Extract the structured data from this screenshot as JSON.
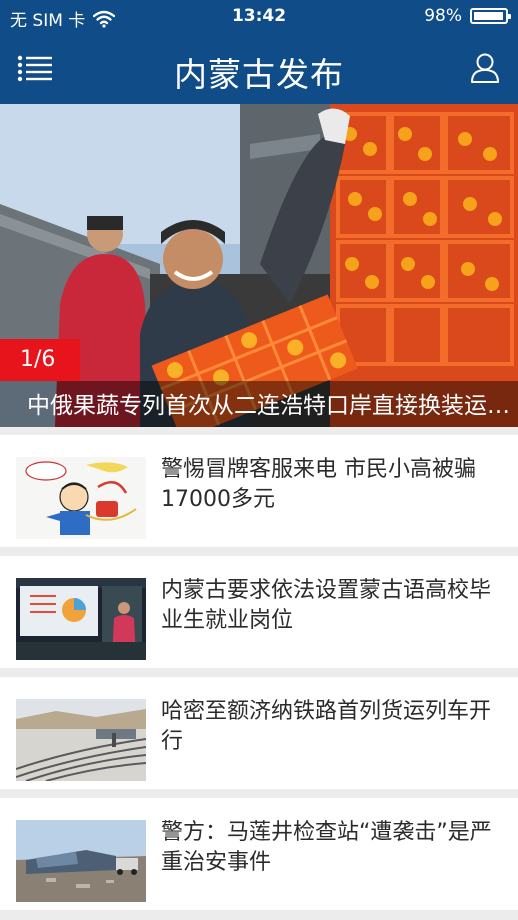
{
  "status_bar": {
    "carrier": "无 SIM 卡",
    "time": "13:42",
    "battery_percent": "98%",
    "battery_level": 0.98
  },
  "nav": {
    "title": "内蒙古发布",
    "menu_icon": "list-menu-icon",
    "user_icon": "user-profile-icon"
  },
  "carousel": {
    "counter": "1/6",
    "caption": "中俄果蔬专列首次从二连浩特口岸直接换装运往俄罗斯"
  },
  "news": [
    {
      "headline": "警惕冒牌客服来电 市民小高被骗17000多元"
    },
    {
      "headline": "内蒙古要求依法设置蒙古语高校毕业生就业岗位"
    },
    {
      "headline": "哈密至额济纳铁路首列货运列车开行"
    },
    {
      "headline": "警方：马莲井检查站“遭袭击”是严重治安事件"
    }
  ],
  "colors": {
    "brand_blue": "#0f4c88",
    "badge_red": "#e8141b",
    "separator_gray": "#ececec"
  }
}
